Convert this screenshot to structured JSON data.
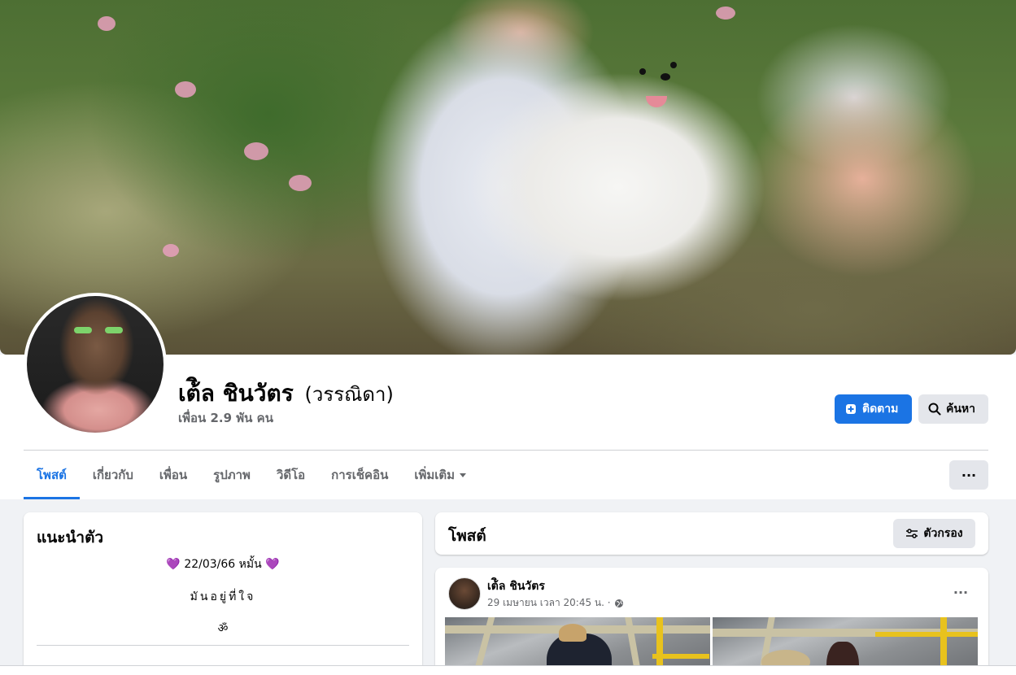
{
  "profile": {
    "name": "เต้ิล ชินวัตร",
    "alt_name": "(วรรณิดา)",
    "friends": "เพื่อน 2.9 พัน คน"
  },
  "actions": {
    "follow_label": "ติดตาม",
    "search_label": "ค้นหา",
    "more_label": "···"
  },
  "tabs": [
    {
      "label": "โพสต์",
      "active": true
    },
    {
      "label": "เกี่ยวกับ",
      "active": false
    },
    {
      "label": "เพื่อน",
      "active": false
    },
    {
      "label": "รูปภาพ",
      "active": false
    },
    {
      "label": "วิดีโอ",
      "active": false
    },
    {
      "label": "การเช็คอิน",
      "active": false
    },
    {
      "label": "เพิ่มเติม",
      "active": false
    }
  ],
  "intro": {
    "title": "แนะนำตัว",
    "line1_heart_left": "💜",
    "line1_text": "22/03/66 หมั้น",
    "line1_heart_right": "💜",
    "line2": "มันอยู่ที่ใจ",
    "line3": "ॐ"
  },
  "posts_header": {
    "title": "โพสต์",
    "filter_label": "ตัวกรอง"
  },
  "post": {
    "author": "เต้ิล ชินวัตร",
    "time": "29 เมษายน เวลา 20:45 น. ·",
    "more_label": "···",
    "privacy_icon": "globe-icon"
  },
  "colors": {
    "accent": "#1b74e4",
    "page_bg": "#f0f2f5",
    "secondary_text": "#65676b",
    "heart": "#8c52c6"
  }
}
